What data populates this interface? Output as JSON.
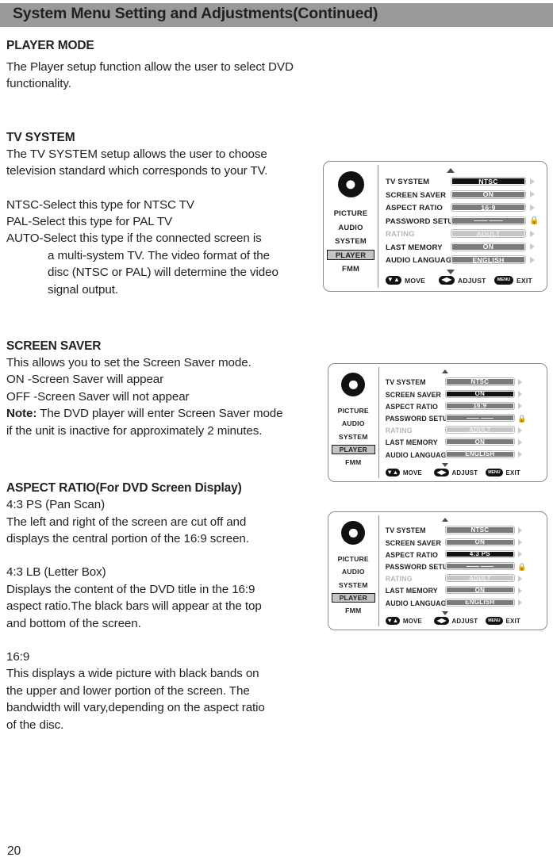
{
  "header": {
    "title": "System Menu Setting and Adjustments(Continued)"
  },
  "page": {
    "number": "20"
  },
  "sections": [
    {
      "heading": "PLAYER MODE",
      "paragraphs": [
        "The Player setup function allow the user to select DVD",
        "functionality."
      ]
    },
    {
      "heading": "TV SYSTEM",
      "paragraphs": [
        "The TV SYSTEM setup allows the user to choose",
        "television standard which corresponds to your TV."
      ],
      "paragraphs2": [
        "NTSC-Select this type for NTSC TV",
        "PAL-Select this type for PAL TV",
        "AUTO-Select this type if the connected screen is"
      ],
      "hanging": [
        "a multi-system TV. The video format of the",
        "disc (NTSC or PAL) will determine the video",
        "signal output."
      ]
    },
    {
      "heading": "SCREEN SAVER",
      "paragraphs": [
        "This allows you to set the Screen Saver mode.",
        "ON -Screen Saver will appear",
        "OFF -Screen Saver will not appear"
      ],
      "note_label": "Note:",
      "note_rest": " The DVD player will enter Screen Saver mode",
      "note_line2": "if the unit is inactive for approximately 2 minutes."
    },
    {
      "heading": "ASPECT RATIO(For DVD Screen Display)",
      "paragraphs": [
        "4:3 PS (Pan Scan)",
        "The left and right of the screen are cut off and",
        "displays the central portion of the 16:9 screen."
      ],
      "paragraphs2": [
        "4:3 LB (Letter Box)",
        "Displays the content of the DVD title in the 16:9",
        "aspect ratio.The black bars will appear at the top",
        "and bottom of the screen."
      ],
      "paragraphs3": [
        "16:9",
        "This displays a wide picture with black bands on",
        "the upper and lower portion of the screen. The",
        "bandwidth will vary,depending on the aspect ratio",
        "of the disc."
      ]
    }
  ],
  "osd": {
    "categories": [
      "PICTURE",
      "AUDIO",
      "SYSTEM",
      "PLAYER",
      "FMM"
    ],
    "selected_category": "PLAYER",
    "rows": [
      {
        "label": "TV SYSTEM",
        "value": "NTSC"
      },
      {
        "label": "SCREEN SAVER",
        "value": "ON"
      },
      {
        "label": "ASPECT RATIO",
        "value": "16:9"
      },
      {
        "label": "PASSWORD SETUP",
        "value": "——  ——"
      },
      {
        "label": "RATING",
        "value": "ADULT"
      },
      {
        "label": "LAST MEMORY",
        "value": "ON"
      },
      {
        "label": "AUDIO LANGUAGE",
        "value": "ENGLISH"
      }
    ],
    "hints": {
      "move": "MOVE",
      "adjust": "ADJUST",
      "exit": "EXIT",
      "menu_button": "MENU"
    },
    "panels": [
      {
        "highlight_row": "TV SYSTEM",
        "aspect_value": "16:9"
      },
      {
        "highlight_row": "SCREEN SAVER",
        "aspect_value": "16:9"
      },
      {
        "highlight_row": "ASPECT RATIO",
        "aspect_value": "4:3 PS"
      }
    ],
    "colors": {
      "value_bar": "#7b7b7b",
      "value_bar_selected": "#111111",
      "value_bar_disabled": "#c6c6c6",
      "category_selected": "#c4c4c4",
      "header_bar": "#9a9a9a"
    }
  }
}
